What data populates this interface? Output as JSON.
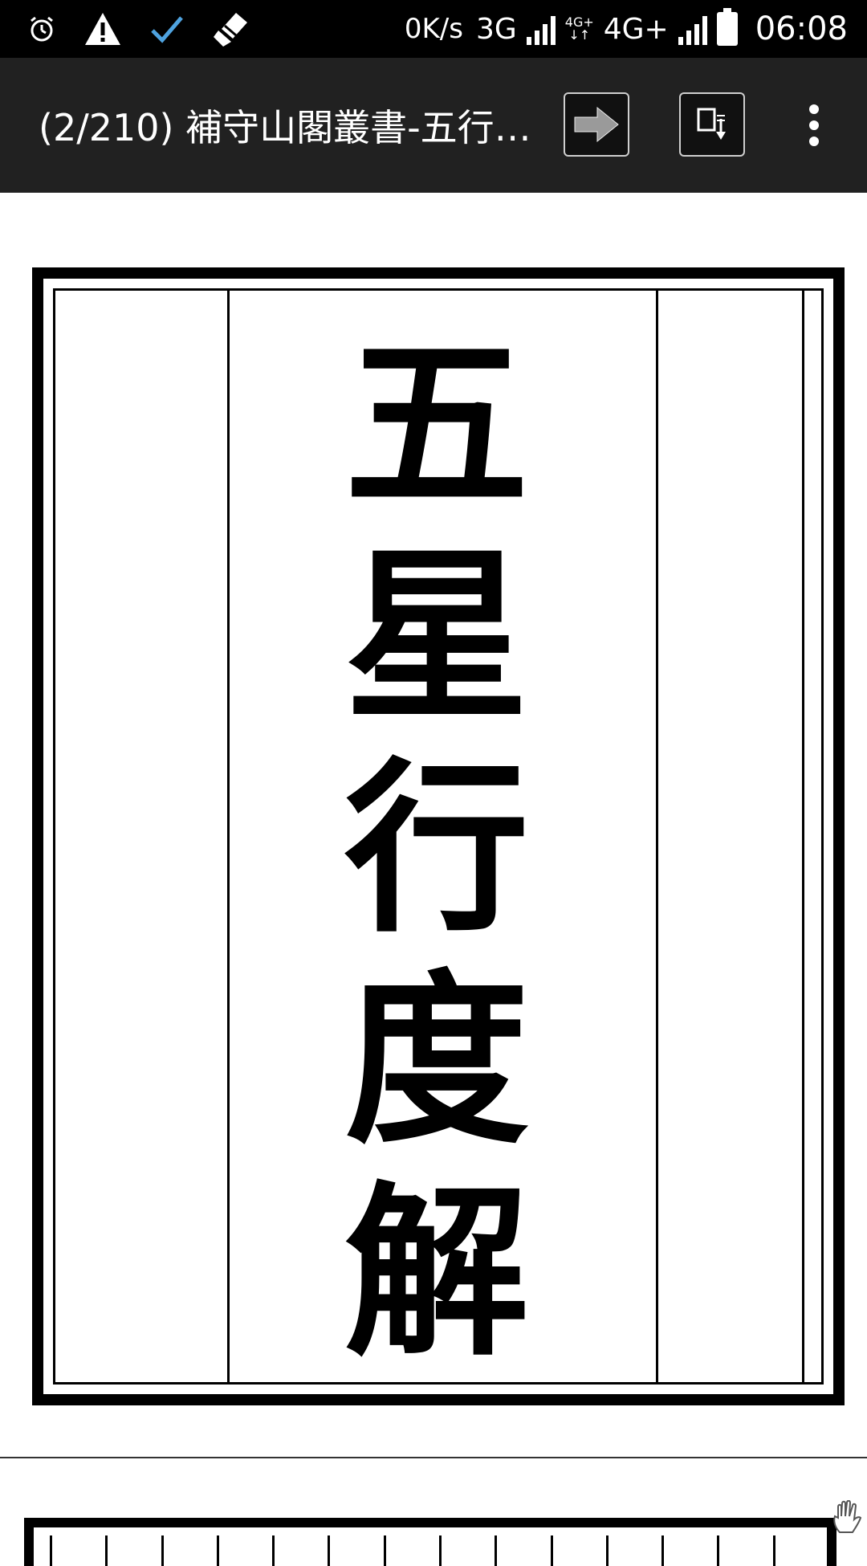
{
  "status_bar": {
    "net_speed": "0K/s",
    "net_type_1": "3G",
    "net_type_2_small": "4G+",
    "net_type_2": "4G+",
    "time": "06:08",
    "icons": [
      "alarm-icon",
      "warning-icon",
      "check-icon",
      "broom-icon",
      "signal-icon",
      "battery-icon"
    ]
  },
  "toolbar": {
    "title": "(2/210) 補守山閣叢書-五行…",
    "next_icon": "arrow-right-icon",
    "fit_icon": "fit-page-icon",
    "menu_icon": "overflow-menu-icon"
  },
  "document": {
    "page_title_chars": [
      "五",
      "星",
      "行",
      "度",
      "解"
    ]
  },
  "colors": {
    "toolbar_bg": "#212121",
    "status_bg": "#000000",
    "page_bg": "#ffffff"
  }
}
